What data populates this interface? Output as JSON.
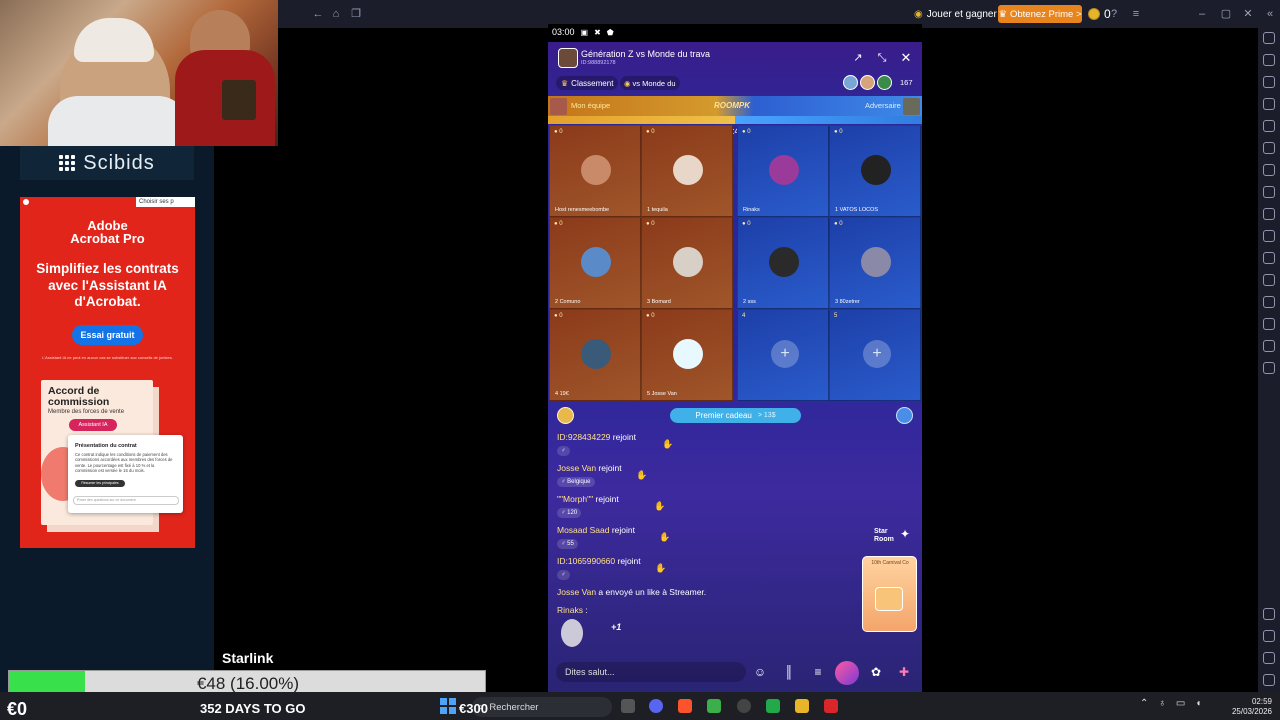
{
  "emulator": {
    "jouer_label": "Jouer et gagner",
    "prime_label": "Obtenez Prime >",
    "coins": "0"
  },
  "stream": {
    "sponsor": "Scibids",
    "goal_label": "Starlink",
    "goal_text": "€48 (16.00%)",
    "goal_progress_fraction": 0.16,
    "goal_left": "€0",
    "days_left": "352 DAYS TO GO",
    "goal_right": "€300",
    "accent_green": "#38e04b"
  },
  "ad": {
    "choice_label": "Choisir ses p",
    "brand": "Adobe\nAcrobat Pro",
    "headline": "Simplifiez les contrats avec l'Assistant IA d'Acrobat.",
    "cta": "Essai gratuit",
    "disclaimer": "L'Assistant IA ne peut en aucun cas se substituer aux conseils de juristes.",
    "doc_title": "Accord de commission",
    "doc_subtitle": "Membre des forces de vente",
    "ai_badge": "Assistant IA",
    "popup_title": "Présentation du contrat",
    "popup_text": "Ce contrat indique les conditions de paiement des commissions accordées aux membres des forces de vente. Le pourcentage est fixé à 10 % et la commission est versée le 15 du mois.",
    "popup_chip": "Résumer les principales clauses",
    "popup_input": "Poser des questions sur ce document",
    "brand_red": "#e1251b"
  },
  "phone": {
    "time": "03:00",
    "room_title": "Génération Z vs Monde du trava",
    "room_id": "ID:988892178",
    "ranking_label": "Classement",
    "topic_label": "vs Monde du",
    "viewer_count": "167",
    "my_team_label": "Mon équipe",
    "opponent_label": "Adversaire",
    "pk_logo": "ROOMPK",
    "pk_timer": "04:43",
    "seats": [
      {
        "score": "0",
        "name": "renesmeebombe",
        "prefix": "Host"
      },
      {
        "score": "0",
        "name": "tequila",
        "prefix": "1"
      },
      {
        "score": "0",
        "name": "Rinaks",
        "prefix": ""
      },
      {
        "score": "0",
        "name": "VATOS LOCOS",
        "prefix": "1"
      },
      {
        "score": "0",
        "name": "Comuno",
        "prefix": "2"
      },
      {
        "score": "0",
        "name": "Bomard",
        "prefix": "3"
      },
      {
        "score": "0",
        "name": "sss",
        "prefix": "2"
      },
      {
        "score": "0",
        "name": "80zetrer",
        "prefix": "3"
      },
      {
        "score": "0",
        "name": "19€",
        "prefix": "4"
      },
      {
        "score": "0",
        "name": "Josse Van",
        "prefix": "5"
      },
      {
        "score": "",
        "name": "",
        "prefix": "4"
      },
      {
        "score": "",
        "name": "",
        "prefix": "5"
      }
    ],
    "gift_bar_label": "Premier cadeau",
    "gift_bar_count": "> 13$",
    "chat": [
      {
        "name": "ID:928434229",
        "text": "rejoint",
        "badge": ""
      },
      {
        "name": "Josse Van",
        "text": "rejoint",
        "badge": "Belgique"
      },
      {
        "name": "\"\"Morph\"\"",
        "text": "rejoint",
        "badge": "120"
      },
      {
        "name": "Mosaad Saad",
        "text": "rejoint",
        "badge": "55"
      },
      {
        "name": "ID:1065990660",
        "text": "rejoint",
        "badge": ""
      },
      {
        "name": "Josse Van",
        "text": "a envoyé un like à Streamer.",
        "badge": ""
      },
      {
        "name": "Rinaks",
        "text": ":",
        "badge": ""
      }
    ],
    "plus_one": "+1",
    "star_room": "Star\nRoom",
    "carnival_label": "10th Carnival Co",
    "input_placeholder": "Dites salut..."
  },
  "taskbar": {
    "search_placeholder": "Rechercher",
    "time": "02:59",
    "date": "25/03/2026"
  }
}
